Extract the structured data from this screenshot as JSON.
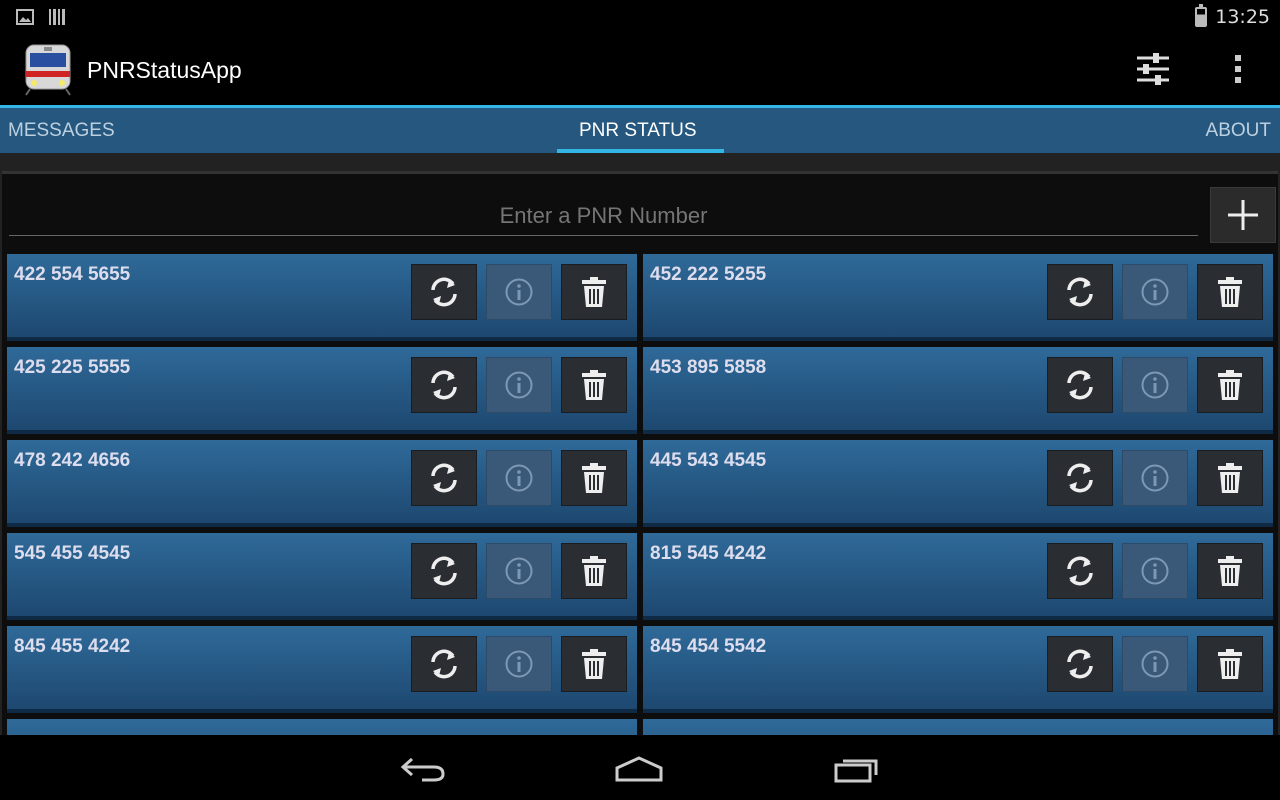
{
  "status_bar": {
    "time": "13:25",
    "icons": [
      "picture-icon",
      "barcode-icon",
      "battery-icon"
    ]
  },
  "action_bar": {
    "title": "PNRStatusApp",
    "icons": [
      "train-icon",
      "sliders-icon",
      "overflow-menu-icon"
    ]
  },
  "tabs": [
    {
      "label": "MESSAGES",
      "active": false
    },
    {
      "label": "PNR STATUS",
      "active": true
    },
    {
      "label": "ABOUT",
      "active": false
    }
  ],
  "input": {
    "placeholder": "Enter a PNR Number",
    "value": ""
  },
  "add_button_icon": "plus-icon",
  "pnr_list": [
    {
      "number": "422 554 5655"
    },
    {
      "number": "452 222 5255"
    },
    {
      "number": "425 225 5555"
    },
    {
      "number": "453 895 5858"
    },
    {
      "number": "478 242 4656"
    },
    {
      "number": "445 543 4545"
    },
    {
      "number": "545 455 4545"
    },
    {
      "number": "815 545 4242"
    },
    {
      "number": "845 455 4242"
    },
    {
      "number": "845 454 5542"
    }
  ],
  "card_actions": [
    "refresh-icon",
    "info-icon",
    "trash-icon"
  ],
  "nav_bar": [
    "back-icon",
    "home-icon",
    "recent-apps-icon"
  ],
  "colors": {
    "accent": "#33b5e5",
    "tab_bar": "#25577f",
    "card_top": "#2f6a99",
    "card_bottom": "#1d4870"
  }
}
